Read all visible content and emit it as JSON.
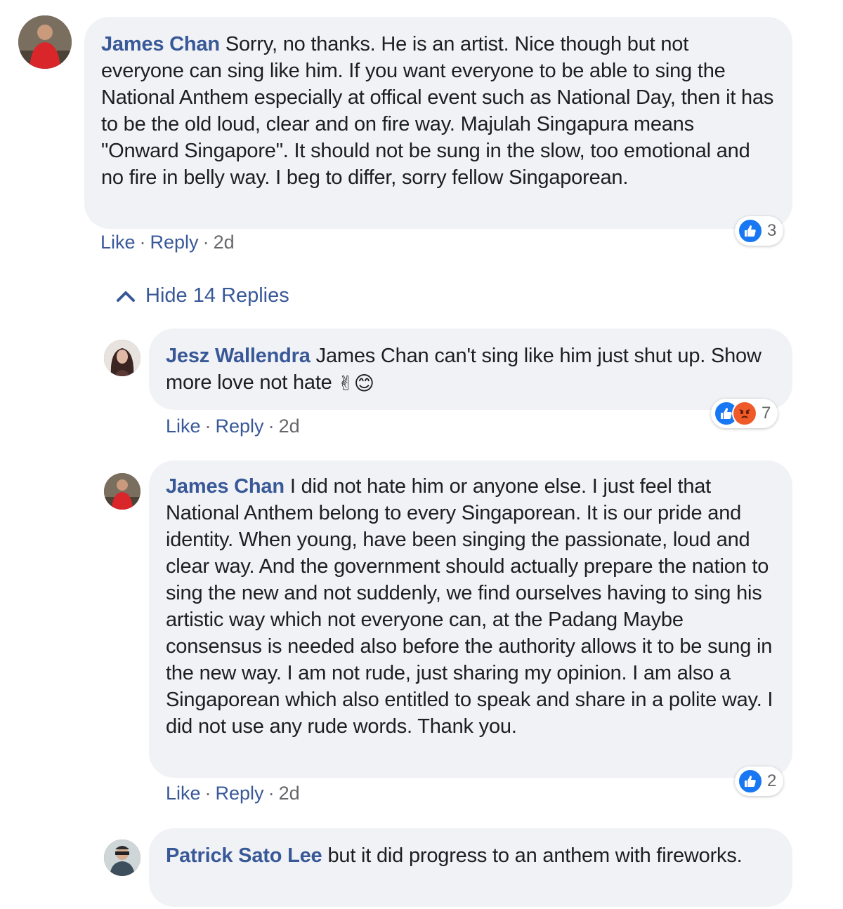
{
  "comments": [
    {
      "author": "James Chan",
      "text": "Sorry, no thanks. He is an artist. Nice though but not everyone can sing like him. If you want everyone to be able to sing the National Anthem especially at offical event such as National Day, then it has to be the old loud, clear and on fire way. Majulah Singapura means \"Onward Singapore\". It should not be sung in the slow, too emotional and no fire in belly way. I beg to differ, sorry fellow Singaporean.",
      "like_label": "Like",
      "reply_label": "Reply",
      "time": "2d",
      "reaction_count": "3"
    }
  ],
  "hide_replies_label": "Hide 14 Replies",
  "replies": [
    {
      "author": "Jesz Wallendra",
      "text": "James Chan can't sing like him just shut up. Show more love not hate",
      "emoji": "✌😊",
      "like_label": "Like",
      "reply_label": "Reply",
      "time": "2d",
      "reaction_count": "7"
    },
    {
      "author": "James Chan",
      "text": "I did not hate him or anyone else. I just feel that National Anthem belong to every Singaporean. It is our pride and identity. When young, have been singing the passionate, loud and clear way. And the government should actually prepare the nation to sing the new and not suddenly, we find ourselves having to sing his artistic way which not everyone can, at the Padang Maybe consensus is needed also before the authority allows it to be sung in the new way. I am not rude, just sharing my opinion. I am also a Singaporean which also entitled to speak and share in a polite way. I did not use any rude words. Thank you.",
      "like_label": "Like",
      "reply_label": "Reply",
      "time": "2d",
      "reaction_count": "2"
    },
    {
      "author": "Patrick Sato Lee",
      "text": "but it did progress to an anthem with fireworks."
    }
  ],
  "separator": "·",
  "colors": {
    "link": "#385898",
    "bubble": "#f0f2f5",
    "like": "#1877f2",
    "angry": "#f05a28"
  },
  "icons": [
    "thumbs-up-icon",
    "angry-face-icon",
    "chevron-up-icon"
  ]
}
